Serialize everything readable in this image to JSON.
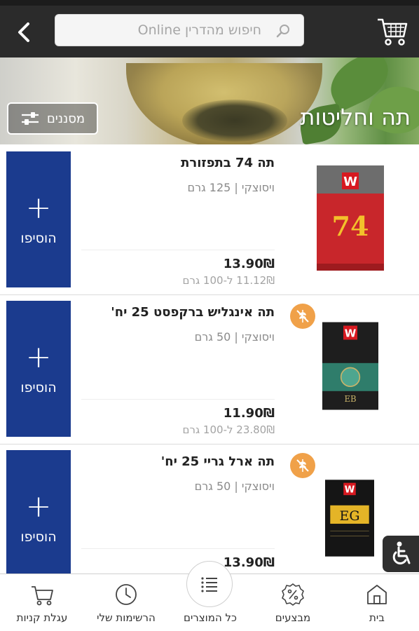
{
  "header": {
    "search_placeholder": "חיפוש מהדרין Online"
  },
  "hero": {
    "title": "תה וחליטות",
    "filter_label": "מסננים"
  },
  "products": [
    {
      "name": "תה 74 בתפזורת",
      "brand": "ויסוצקי",
      "size": "125 גרם",
      "price": "13.90₪",
      "unit_price": "11.12₪ ל-100 גרם",
      "add_label": "הוסיפו",
      "image_text": "74",
      "badge": false
    },
    {
      "name": "תה אינגליש ברקפסט 25 יח'",
      "brand": "ויסוצקי",
      "size": "50 גרם",
      "price": "11.90₪",
      "unit_price": "23.80₪ ל-100 גרם",
      "add_label": "הוסיפו",
      "image_text": "EB",
      "badge": true
    },
    {
      "name": "תה ארל גריי 25 יח'",
      "brand": "ויסוצקי",
      "size": "50 גרם",
      "price": "13.90₪",
      "unit_price": "",
      "add_label": "הוסיפו",
      "image_text": "EG",
      "badge": true
    }
  ],
  "bottom_nav": {
    "home": "בית",
    "deals": "מבצעים",
    "all_products": "כל המוצרים",
    "my_lists": "הרשימות שלי",
    "cart": "עגלת קניות"
  },
  "colors": {
    "topbar": "#2b2b2b",
    "add_button": "#1b3b8e",
    "badge": "#f0a149"
  }
}
